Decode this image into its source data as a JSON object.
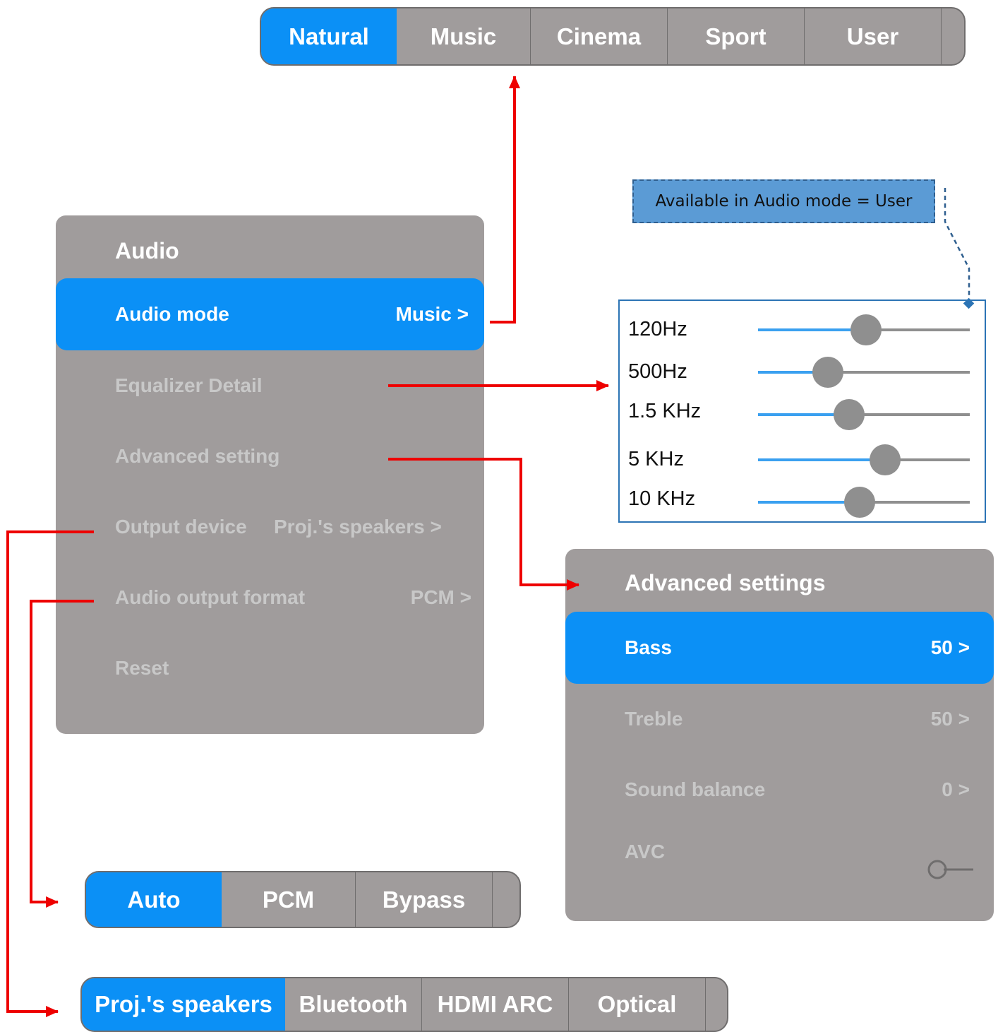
{
  "audio_mode_bar": {
    "items": [
      "Natural",
      "Music",
      "Cinema",
      "Sport",
      "User"
    ],
    "active_index": 0
  },
  "audio_menu": {
    "title": "Audio",
    "items": [
      {
        "label": "Audio mode",
        "value": "Music >"
      },
      {
        "label": "Equalizer Detail",
        "value": ""
      },
      {
        "label": "Advanced setting",
        "value": ""
      },
      {
        "label": "Output device",
        "value": "Proj.'s speakers >"
      },
      {
        "label": "Audio output format",
        "value": "PCM >"
      },
      {
        "label": "Reset",
        "value": ""
      }
    ],
    "selected_index": 0
  },
  "note": {
    "text": "Available in Audio mode = User"
  },
  "equalizer": {
    "bands": [
      {
        "label": "120Hz",
        "level": 0.51
      },
      {
        "label": "500Hz",
        "level": 0.33
      },
      {
        "label": "1.5 KHz",
        "level": 0.43
      },
      {
        "label": "5 KHz",
        "level": 0.6
      },
      {
        "label": "10 KHz",
        "level": 0.48
      }
    ]
  },
  "advanced_settings": {
    "title": "Advanced settings",
    "items": [
      {
        "label": "Bass",
        "value": "50 >"
      },
      {
        "label": "Treble",
        "value": "50 >"
      },
      {
        "label": "Sound balance",
        "value": "0 >"
      },
      {
        "label": "AVC",
        "value": ""
      }
    ],
    "selected_index": 0,
    "avc_toggle_on": false
  },
  "output_format_bar": {
    "items": [
      "Auto",
      "PCM",
      "Bypass"
    ],
    "active_index": 0
  },
  "output_device_bar": {
    "items": [
      "Proj.'s speakers",
      "Bluetooth",
      "HDMI ARC",
      "Optical"
    ],
    "active_index": 0
  },
  "colors": {
    "accent": "#0b90f6",
    "panel": "#a09c9c",
    "connector": "#ee0000",
    "note_bg": "#5b9bd5"
  }
}
